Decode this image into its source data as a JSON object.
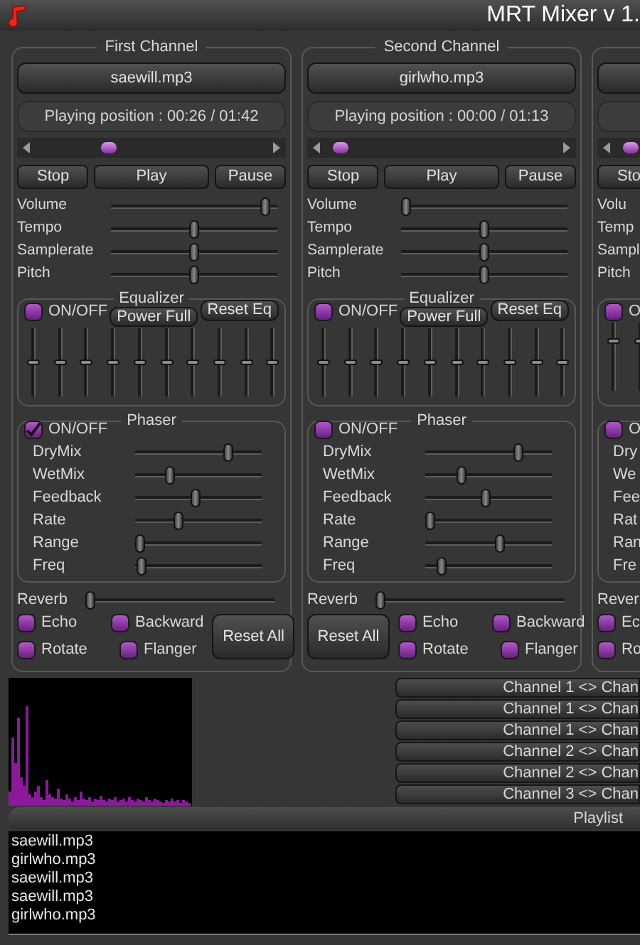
{
  "window": {
    "title": "MRT Mixer v 1."
  },
  "channels": [
    {
      "title": "First Channel",
      "file": "saewill.mp3",
      "position": "Playing position : 00:26 / 01:42",
      "seek": {
        "level": 0.3
      },
      "stop": "Stop",
      "play": "Play",
      "pause": "Pause",
      "sliders": [
        {
          "label": "Volume",
          "level": 0.95
        },
        {
          "label": "Tempo",
          "level": 0.5
        },
        {
          "label": "Samplerate",
          "level": 0.5
        },
        {
          "label": "Pitch",
          "level": 0.5
        }
      ],
      "equalizer": {
        "title": "Equalizer",
        "on": false,
        "on_label": "ON/OFF",
        "power_full": "Power Full",
        "reset": "Reset Eq",
        "bands": [
          {
            "level": 0.5
          },
          {
            "level": 0.5
          },
          {
            "level": 0.5
          },
          {
            "level": 0.5
          },
          {
            "level": 0.5
          },
          {
            "level": 0.5
          },
          {
            "level": 0.5
          },
          {
            "level": 0.5
          },
          {
            "level": 0.5
          },
          {
            "level": 0.5
          }
        ]
      },
      "phaser": {
        "title": "Phaser",
        "on": true,
        "on_label": "ON/OFF",
        "params": [
          {
            "label": "DryMix",
            "level": 0.75
          },
          {
            "label": "WetMix",
            "level": 0.25
          },
          {
            "label": "Feedback",
            "level": 0.47
          },
          {
            "label": "Rate",
            "level": 0.33
          },
          {
            "label": "Range",
            "level": 0.0
          },
          {
            "label": "Freq",
            "level": 0.01
          }
        ]
      },
      "reverb": {
        "label": "Reverb",
        "level": 0.0
      },
      "effects": [
        [
          {
            "label": "Echo",
            "checked": false
          },
          {
            "label": "Backward",
            "checked": false
          }
        ],
        [
          {
            "label": "Rotate",
            "checked": false
          },
          {
            "label": "Flanger",
            "checked": false
          }
        ]
      ],
      "reset_all": "Reset All"
    },
    {
      "title": "Second Channel",
      "file": "girlwho.mp3",
      "position": "Playing position : 00:00 / 01:13",
      "seek": {
        "level": 0.03
      },
      "stop": "Stop",
      "play": "Play",
      "pause": "Pause",
      "sliders": [
        {
          "label": "Volume",
          "level": 0.0
        },
        {
          "label": "Tempo",
          "level": 0.5
        },
        {
          "label": "Samplerate",
          "level": 0.5
        },
        {
          "label": "Pitch",
          "level": 0.5
        }
      ],
      "equalizer": {
        "title": "Equalizer",
        "on": false,
        "on_label": "ON/OFF",
        "power_full": "Power Full",
        "reset": "Reset Eq",
        "bands": [
          {
            "level": 0.5
          },
          {
            "level": 0.5
          },
          {
            "level": 0.5
          },
          {
            "level": 0.5
          },
          {
            "level": 0.5
          },
          {
            "level": 0.5
          },
          {
            "level": 0.5
          },
          {
            "level": 0.5
          },
          {
            "level": 0.5
          },
          {
            "level": 0.5
          }
        ]
      },
      "phaser": {
        "title": "Phaser",
        "on": false,
        "on_label": "ON/OFF",
        "params": [
          {
            "label": "DryMix",
            "level": 0.75
          },
          {
            "label": "WetMix",
            "level": 0.27
          },
          {
            "label": "Feedback",
            "level": 0.47
          },
          {
            "label": "Rate",
            "level": 0.0
          },
          {
            "label": "Range",
            "level": 0.6
          },
          {
            "label": "Freq",
            "level": 0.1
          }
        ]
      },
      "reverb": {
        "label": "Reverb",
        "level": 0.0
      },
      "effects": [
        [
          {
            "label": "Echo",
            "checked": false
          },
          {
            "label": "Backward",
            "checked": false
          }
        ],
        [
          {
            "label": "Rotate",
            "checked": false
          },
          {
            "label": "Flanger",
            "checked": false
          }
        ]
      ],
      "reset_all": "Reset All"
    },
    {
      "seek": {
        "level": 0.03
      },
      "stop": "Sto",
      "sliders": [
        {
          "label": "Volu"
        },
        {
          "label": "Temp"
        },
        {
          "label": "Sampl"
        },
        {
          "label": "Pitch"
        }
      ],
      "equalizer": {
        "on": false,
        "on_label": "O",
        "bands": [
          {
            "level": 0.75
          },
          {
            "level": 0.75
          }
        ]
      },
      "phaser": {
        "on": false,
        "on_label": "O",
        "params": [
          {
            "label": "Dry"
          },
          {
            "label": "We"
          },
          {
            "label": "Fee"
          },
          {
            "label": "Rat"
          },
          {
            "label": "Ran"
          },
          {
            "label": "Fre"
          }
        ]
      },
      "reverb": {
        "label": "Rever"
      },
      "effects": [
        [
          {
            "label": "Ec",
            "checked": false
          }
        ],
        [
          {
            "label": "Ro",
            "checked": false
          }
        ]
      ]
    }
  ],
  "swap_buttons": [
    "Channel 1 <> Chan",
    "Channel 1 <> Chan",
    "Channel 1 <> Chan",
    "Channel 2 <> Chan",
    "Channel 2 <> Chan",
    "Channel 3 <> Chan"
  ],
  "playlist": {
    "title": "Playlist",
    "items": [
      "saewill.mp3",
      "girlwho.mp3",
      "saewill.mp3",
      "saewill.mp3",
      "girlwho.mp3"
    ]
  }
}
